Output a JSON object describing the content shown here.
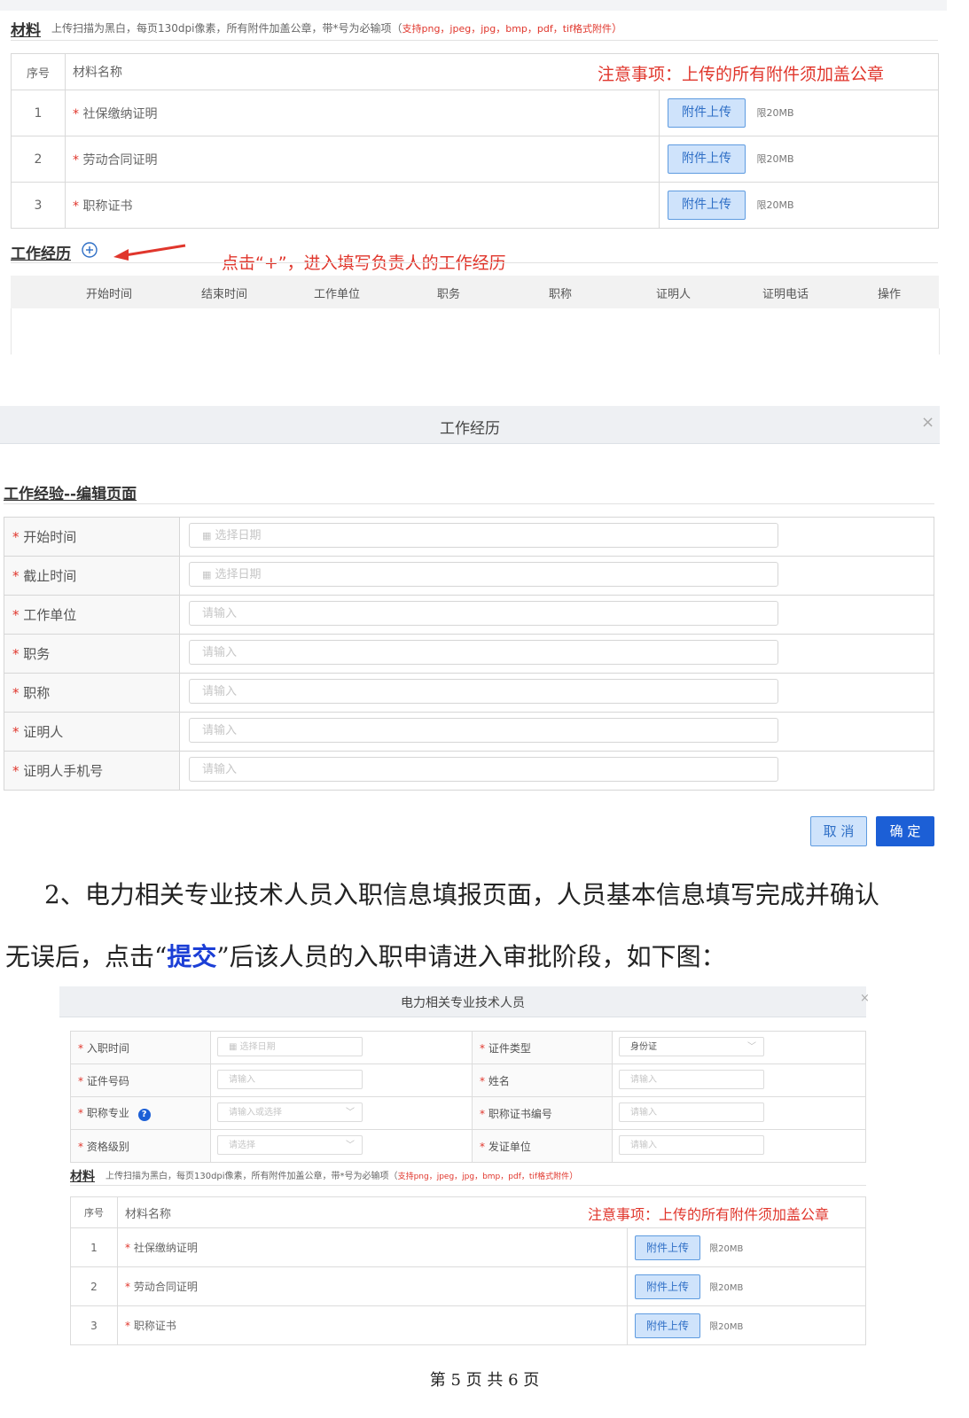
{
  "top_materials": {
    "title": "材料",
    "note": "上传扫描为黑白，每页130dpi像素，所有附件加盖公章，带*号为必输项（",
    "note_red": "支持png，jpeg，jpg，bmp，pdf，tif格式附件",
    "note_end": "）",
    "col_index": "序号",
    "col_name": "材料名称",
    "warning": "注意事项：上传的所有附件须加盖公章",
    "rows": [
      {
        "index": "1",
        "star": "*",
        "name": "社保缴纳证明",
        "button": "附件上传",
        "limit": "限20MB"
      },
      {
        "index": "2",
        "star": "*",
        "name": "劳动合同证明",
        "button": "附件上传",
        "limit": "限20MB"
      },
      {
        "index": "3",
        "star": "*",
        "name": "职称证书",
        "button": "附件上传",
        "limit": "限20MB"
      }
    ]
  },
  "work_history": {
    "title": "工作经历",
    "add_icon": "plus-circle-icon",
    "annotation": "点击“+”，进入填写负责人的工作经历",
    "columns": [
      "开始时间",
      "结束时间",
      "工作单位",
      "职务",
      "职称",
      "证明人",
      "证明电话",
      "操作"
    ]
  },
  "modal": {
    "title": "工作经历",
    "close": "×",
    "section_title": "工作经验--编辑页面",
    "fields": [
      {
        "star": "*",
        "label": "开始时间",
        "placeholder": "选择日期",
        "icon": "calendar-icon"
      },
      {
        "star": "*",
        "label": "截止时间",
        "placeholder": "选择日期",
        "icon": "calendar-icon"
      },
      {
        "star": "*",
        "label": "工作单位",
        "placeholder": "请输入"
      },
      {
        "star": "*",
        "label": "职务",
        "placeholder": "请输入"
      },
      {
        "star": "*",
        "label": "职称",
        "placeholder": "请输入"
      },
      {
        "star": "*",
        "label": "证明人",
        "placeholder": "请输入"
      },
      {
        "star": "*",
        "label": "证明人手机号",
        "placeholder": "请输入"
      }
    ],
    "cancel": "取 消",
    "confirm": "确 定"
  },
  "paragraph": {
    "line1": "2、电力相关专业技术人员入职信息填报页面，人员基本信息填写完成并确认",
    "line2_a": "无误后，点击“",
    "line2_link": "提交",
    "line2_b": "”后该人员的入职申请进入审批阶段，如下图："
  },
  "bottom_form": {
    "title": "电力相关专业技术人员",
    "close": "×",
    "rows": [
      {
        "l_label": "入职时间",
        "l_value": "选择日期",
        "l_type": "date",
        "r_label": "证件类型",
        "r_value": "身份证",
        "r_type": "select-val"
      },
      {
        "l_label": "证件号码",
        "l_value": "请输入",
        "l_type": "text",
        "r_label": "姓名",
        "r_value": "请输入",
        "r_type": "text"
      },
      {
        "l_label": "职称专业",
        "l_value": "请输入或选择",
        "l_type": "select",
        "r_label": "职称证书编号",
        "r_value": "请输入",
        "r_type": "text"
      },
      {
        "l_label": "资格级别",
        "l_value": "请选择",
        "l_type": "select",
        "r_label": "发证单位",
        "r_value": "请输入",
        "r_type": "text"
      }
    ],
    "help_icon": "?",
    "materials_title": "材料",
    "materials_note": "上传扫描为黑白，每页130dpi像素，所有附件加盖公章，带*号为必输项（",
    "materials_note_red": "支持png，jpeg，jpg，bmp，pdf，tif格式附件",
    "materials_note_end": "）",
    "col_index": "序号",
    "col_name": "材料名称",
    "warning": "注意事项：上传的所有附件须加盖公章",
    "mrows": [
      {
        "index": "1",
        "name": "社保缴纳证明",
        "button": "附件上传",
        "limit": "限20MB"
      },
      {
        "index": "2",
        "name": "劳动合同证明",
        "button": "附件上传",
        "limit": "限20MB"
      },
      {
        "index": "3",
        "name": "职称证书",
        "button": "附件上传",
        "limit": "限20MB"
      }
    ]
  },
  "footer": {
    "page": "第 5 页 共 6 页"
  }
}
